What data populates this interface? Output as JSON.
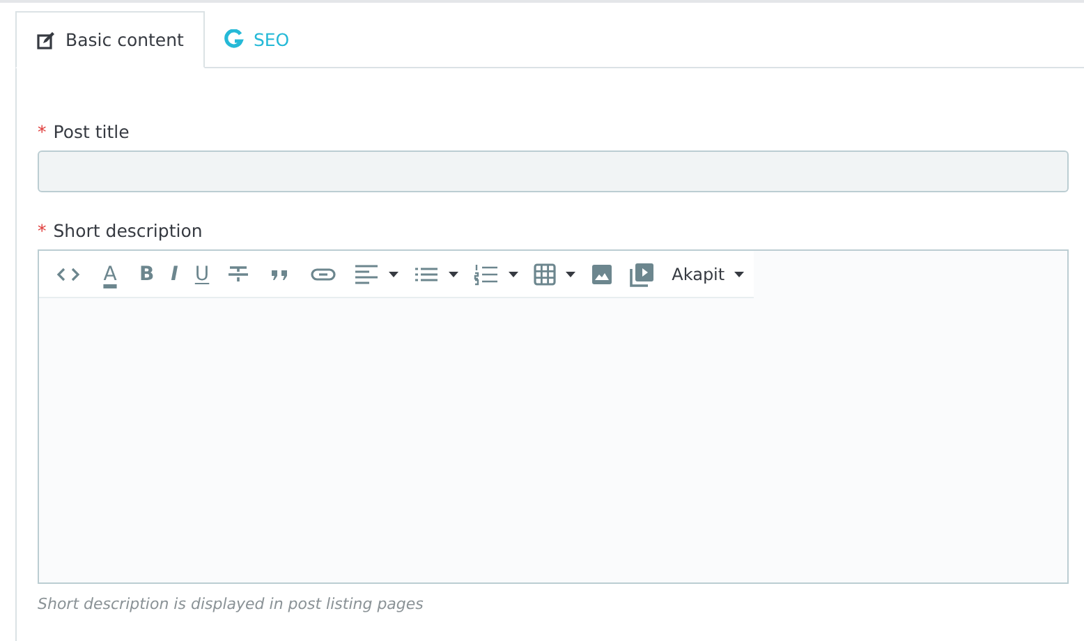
{
  "tabs": [
    {
      "label": "Basic content",
      "selected": true
    },
    {
      "label": "SEO",
      "selected": false
    }
  ],
  "fields": [
    {
      "label": "Post title",
      "marker": "*",
      "kind": "input"
    },
    {
      "label": "Short description",
      "marker": "*",
      "kind": "editor",
      "help": "Short description is displayed in post listing pages"
    }
  ],
  "toolbar": [
    {
      "kind": "icon",
      "dropdown": false
    },
    {
      "kind": "glyph",
      "text": "A",
      "dropdown": false
    },
    {
      "kind": "glyph",
      "text": "B",
      "dropdown": false
    },
    {
      "kind": "glyph",
      "text": "I",
      "dropdown": false
    },
    {
      "kind": "glyph",
      "text": "U",
      "dropdown": false
    },
    {
      "kind": "icon",
      "dropdown": false
    },
    {
      "kind": "icon",
      "dropdown": false
    },
    {
      "kind": "icon",
      "dropdown": false
    },
    {
      "kind": "icon",
      "dropdown": true
    },
    {
      "kind": "icon",
      "dropdown": true
    },
    {
      "kind": "icon",
      "dropdown": true
    },
    {
      "kind": "icon",
      "dropdown": true
    },
    {
      "kind": "icon",
      "dropdown": false
    },
    {
      "kind": "icon",
      "dropdown": false
    },
    {
      "kind": "menu",
      "text": "Akapit",
      "dropdown": true
    }
  ]
}
